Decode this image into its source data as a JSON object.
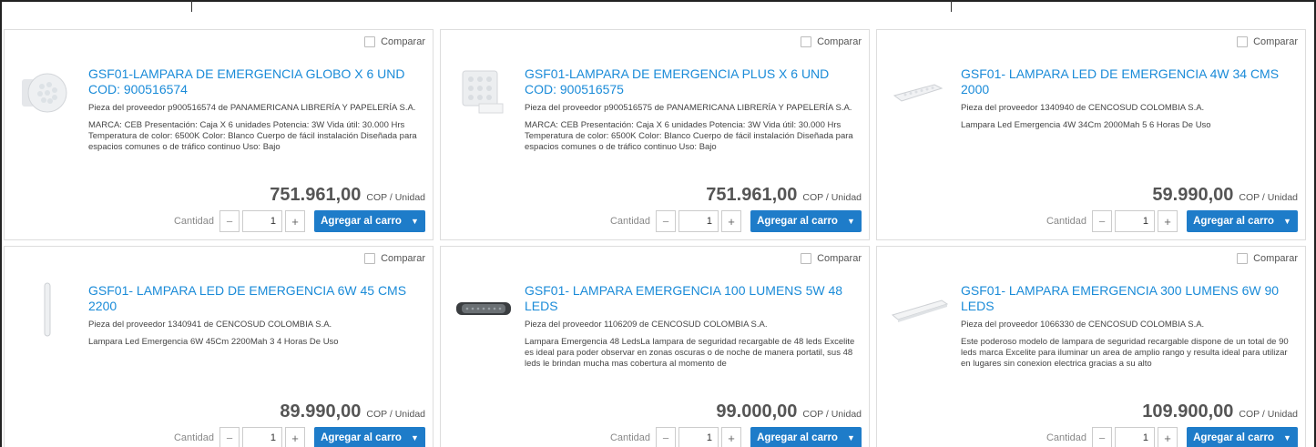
{
  "compare_label": "Comparar",
  "quantity_label": "Cantidad",
  "add_to_cart_label": "Agregar al carro",
  "products": [
    {
      "title": "GSF01-LAMPARA DE EMERGENCIA GLOBO X 6 UND cod: 900516574",
      "supplier": "Pieza del proveedor p900516574 de PANAMERICANA LIBRERÍA Y PAPELERÍA S.A.",
      "description": "MARCA: CEB Presentación: Caja X 6 unidades Potencia: 3W Vida útil: 30.000 Hrs Temperatura de color: 6500K Color: Blanco Cuerpo de fácil instalación Diseñada para espacios comunes o de tráfico continuo Uso: Bajo",
      "price": "751.961,00",
      "unit": "COP / Unidad",
      "quantity": "1",
      "image_icon": "round-led-lamp-icon"
    },
    {
      "title": "GSF01-LAMPARA DE EMERGENCIA PLUS X 6 UND cod: 900516575",
      "supplier": "Pieza del proveedor p900516575 de PANAMERICANA LIBRERÍA Y PAPELERÍA S.A.",
      "description": "MARCA: CEB Presentación: Caja X 6 unidades Potencia: 3W Vida útil: 30.000 Hrs Temperatura de color: 6500K Color: Blanco Cuerpo de fácil instalación Diseñada para espacios comunes o de tráfico continuo Uso: Bajo",
      "price": "751.961,00",
      "unit": "COP / Unidad",
      "quantity": "1",
      "image_icon": "square-led-lamp-icon"
    },
    {
      "title": "GSF01- LAMPARA LED DE EMERGENCIA 4W 34 CMS 2000",
      "supplier": "Pieza del proveedor 1340940 de CENCOSUD COLOMBIA S.A.",
      "description": "Lampara Led Emergencia 4W 34Cm 2000Mah 5 6 Horas De Uso",
      "price": "59.990,00",
      "unit": "COP / Unidad",
      "quantity": "1",
      "image_icon": "bar-lamp-icon"
    },
    {
      "title": "GSF01- LAMPARA LED DE EMERGENCIA 6W 45 CMS 2200",
      "supplier": "Pieza del proveedor 1340941 de CENCOSUD COLOMBIA S.A.",
      "description": "Lampara Led Emergencia 6W 45Cm 2200Mah 3 4 Horas De Uso",
      "price": "89.990,00",
      "unit": "COP / Unidad",
      "quantity": "1",
      "image_icon": "tube-lamp-icon"
    },
    {
      "title": "GSF01- LAMPARA EMERGENCIA 100 LUMENS 5W 48 LEDS",
      "supplier": "Pieza del proveedor 1106209 de CENCOSUD COLOMBIA S.A.",
      "description": "Lampara Emergencia 48 LedsLa lampara de seguridad recargable de 48 leds Excelite es ideal para poder observar en zonas oscuras o de noche de manera portatil, sus 48 leds le brindan mucha mas cobertura al momento de",
      "price": "99.000,00",
      "unit": "COP / Unidad",
      "quantity": "1",
      "image_icon": "dark-led-panel-icon"
    },
    {
      "title": "GSF01- LAMPARA EMERGENCIA 300 LUMENS 6W 90 LEDS",
      "supplier": "Pieza del proveedor 1066330 de CENCOSUD COLOMBIA S.A.",
      "description": "Este poderoso modelo de lampara de seguridad recargable dispone de un total de 90 leds marca Excelite para iluminar un area de amplio rango y resulta ideal para utilizar en lugares sin conexion electrica gracias a su alto",
      "price": "109.900,00",
      "unit": "COP / Unidad",
      "quantity": "1",
      "image_icon": "long-bar-lamp-icon"
    }
  ]
}
